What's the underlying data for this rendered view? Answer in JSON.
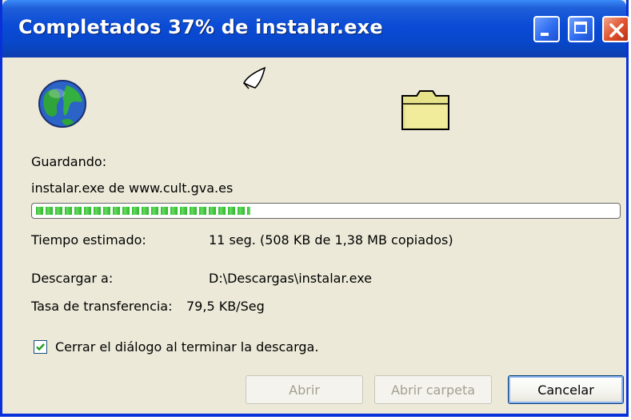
{
  "window": {
    "title": "Completados 37% de instalar.exe"
  },
  "status": {
    "saving_label": "Guardando:",
    "file_source": "instalar.exe de www.cult.gva.es",
    "progress_fraction": 0.37,
    "time_label": "Tiempo estimado:",
    "time_value": "11 seg. (508 KB de 1,38 MB copiados)",
    "download_to_label": "Descargar a:",
    "download_to_value": "D:\\Descargas\\instalar.exe",
    "rate_label": "Tasa de transferencia:",
    "rate_value": "79,5 KB/Seg"
  },
  "options": {
    "close_on_finish_label": "Cerrar el diálogo al terminar la descarga.",
    "close_on_finish_checked": true
  },
  "buttons": {
    "open_label": "Abrir",
    "open_folder_label": "Abrir carpeta",
    "cancel_label": "Cancelar"
  },
  "icons": {
    "globe": "globe-icon",
    "paper": "flying-paper-icon",
    "folder": "folder-icon"
  },
  "colors": {
    "titlebar": "#0a4bd6",
    "progress": "#2fb62f",
    "dialog_bg": "#ece9d8"
  }
}
